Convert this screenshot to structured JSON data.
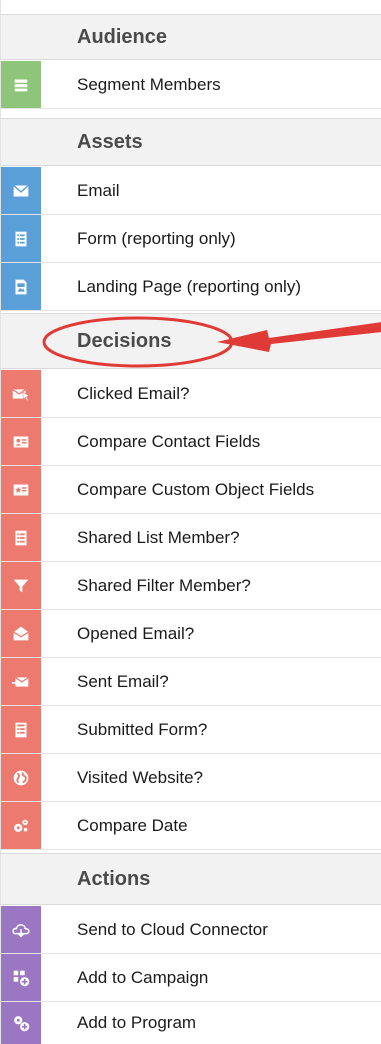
{
  "colors": {
    "audience": "#8fc57a",
    "assets": "#5b9fd9",
    "decisions": "#ec7a6f",
    "actions": "#9b77c3",
    "annotation": "#e03a36"
  },
  "sections": {
    "audience": {
      "title": "Audience",
      "items": [
        {
          "label": "Segment Members",
          "icon": "database-icon"
        }
      ]
    },
    "assets": {
      "title": "Assets",
      "items": [
        {
          "label": "Email",
          "icon": "envelope-icon"
        },
        {
          "label": "Form (reporting only)",
          "icon": "form-icon"
        },
        {
          "label": "Landing Page (reporting only)",
          "icon": "landing-page-icon"
        }
      ]
    },
    "decisions": {
      "title": "Decisions",
      "items": [
        {
          "label": "Clicked Email?",
          "icon": "clicked-email-icon"
        },
        {
          "label": "Compare Contact Fields",
          "icon": "contact-card-icon"
        },
        {
          "label": "Compare Custom Object Fields",
          "icon": "custom-object-icon"
        },
        {
          "label": "Shared List Member?",
          "icon": "list-icon"
        },
        {
          "label": "Shared Filter Member?",
          "icon": "filter-icon"
        },
        {
          "label": "Opened Email?",
          "icon": "opened-email-icon"
        },
        {
          "label": "Sent Email?",
          "icon": "sent-email-icon"
        },
        {
          "label": "Submitted Form?",
          "icon": "submitted-form-icon"
        },
        {
          "label": "Visited Website?",
          "icon": "globe-icon"
        },
        {
          "label": "Compare Date",
          "icon": "gears-icon"
        }
      ]
    },
    "actions": {
      "title": "Actions",
      "items": [
        {
          "label": "Send to Cloud Connector",
          "icon": "cloud-icon"
        },
        {
          "label": "Add to Campaign",
          "icon": "add-campaign-icon"
        },
        {
          "label": "Add to Program",
          "icon": "add-program-icon"
        }
      ]
    }
  }
}
